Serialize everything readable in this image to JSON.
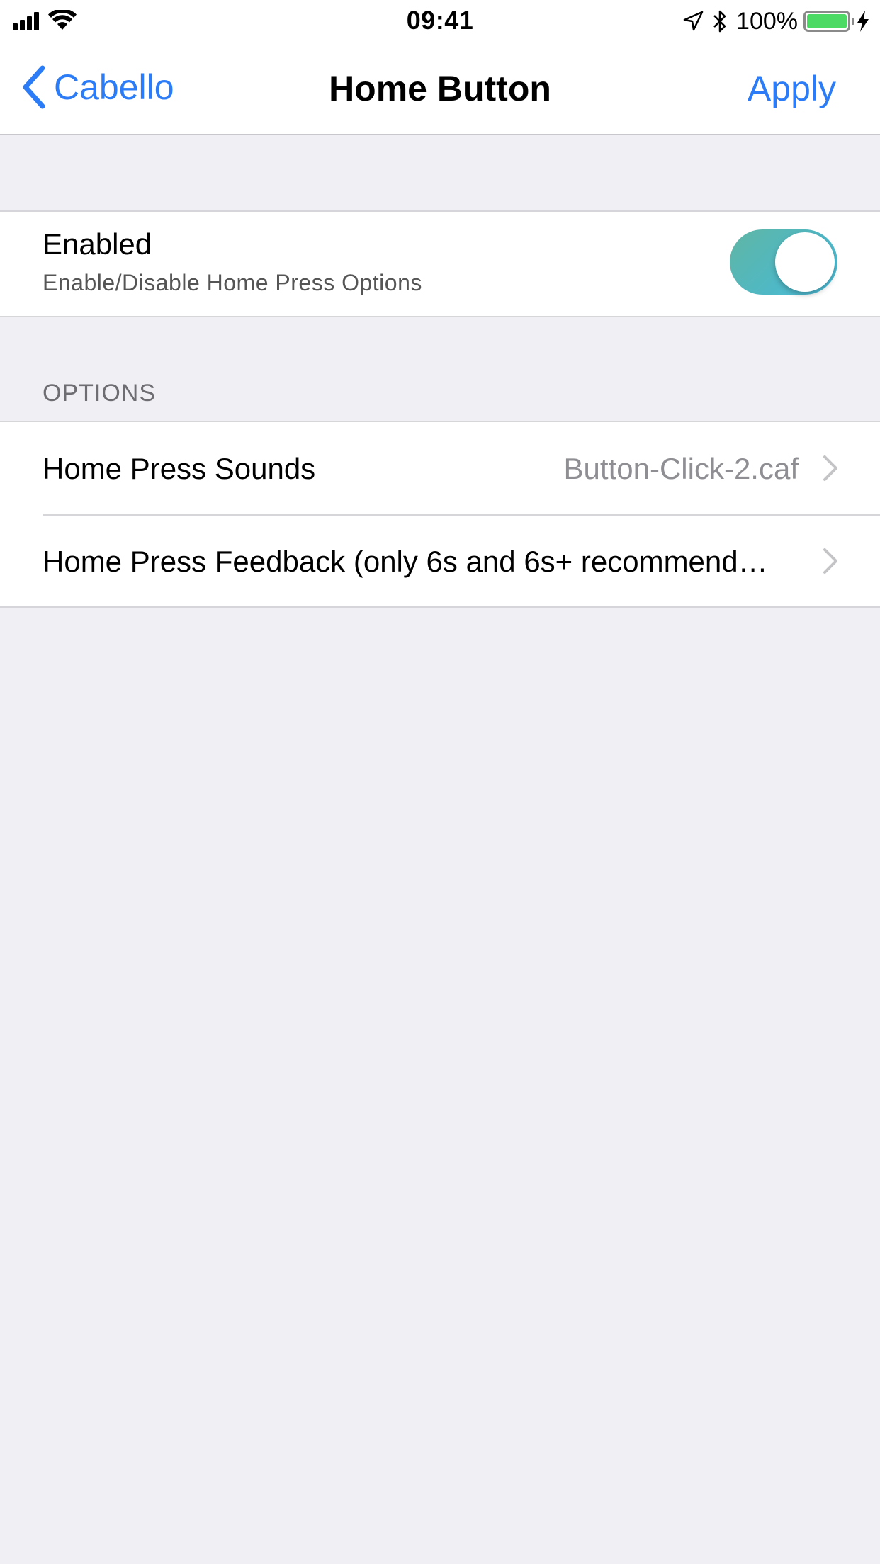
{
  "status_bar": {
    "time": "09:41",
    "battery_percent": "100%",
    "battery_level": 1.0,
    "icons": [
      "signal-icon",
      "wifi-icon",
      "location-icon",
      "bluetooth-icon",
      "battery-icon",
      "charging-icon"
    ]
  },
  "nav": {
    "back_label": "Cabello",
    "title": "Home Button",
    "apply_label": "Apply"
  },
  "enabled": {
    "title": "Enabled",
    "subtitle": "Enable/Disable Home Press Options",
    "on": true
  },
  "options": {
    "header": "OPTIONS",
    "rows": [
      {
        "label": "Home Press Sounds",
        "value": "Button-Click-2.caf"
      },
      {
        "label": "Home Press Feedback (only 6s and 6s+ recommend…",
        "value": ""
      }
    ]
  },
  "colors": {
    "accent": "#2b7cf6",
    "background": "#efeff4",
    "toggle_on": "#4fb8c6",
    "battery": "#4cd964"
  }
}
